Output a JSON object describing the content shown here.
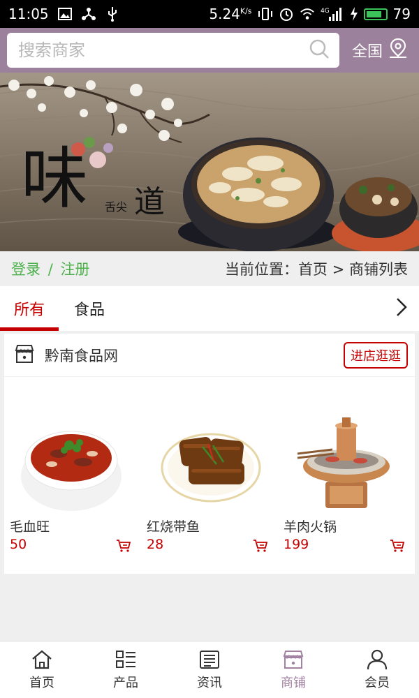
{
  "status_bar": {
    "time": "11:05",
    "speed": "5.24",
    "speed_unit": "K/s",
    "network": "4G",
    "battery": "79",
    "battery_level": 0.79
  },
  "search": {
    "placeholder": "搜索商家",
    "region": "全国"
  },
  "breadcrumb": {
    "login": "登录",
    "separator": "/",
    "register": "注册",
    "location": "当前位置：首页 > 商铺列表"
  },
  "tabs": [
    {
      "label": "所有",
      "active": true
    },
    {
      "label": "食品",
      "active": false
    }
  ],
  "banner": {
    "calligraphy_main": "味",
    "calligraphy_small": "舌尖",
    "calligraphy_dao": "道"
  },
  "shop": {
    "name": "黔南食品网",
    "enter_label": "进店逛逛"
  },
  "products": [
    {
      "name": "毛血旺",
      "price": "50"
    },
    {
      "name": "红烧带鱼",
      "price": "28"
    },
    {
      "name": "羊肉火锅",
      "price": "199"
    }
  ],
  "nav": [
    {
      "label": "首页",
      "icon": "home-icon"
    },
    {
      "label": "产品",
      "icon": "grid-list-icon"
    },
    {
      "label": "资讯",
      "icon": "news-icon"
    },
    {
      "label": "商铺",
      "icon": "store-icon",
      "active": true
    },
    {
      "label": "会员",
      "icon": "user-icon"
    }
  ],
  "colors": {
    "header": "#9b819b",
    "accent_red": "#c40000",
    "auth_green": "#4db24d",
    "nav_active": "#a282a2"
  }
}
